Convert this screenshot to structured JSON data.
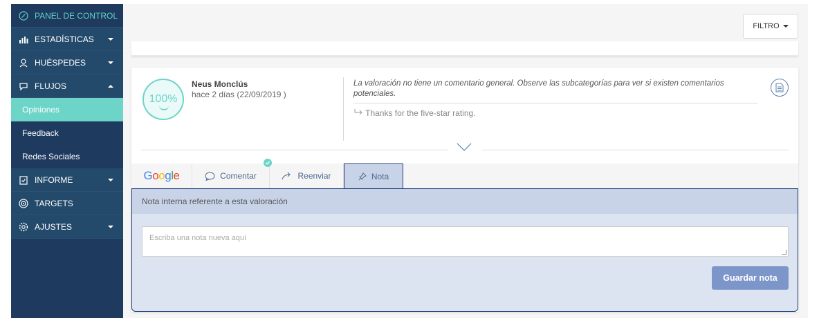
{
  "sidebar": {
    "top": {
      "label": "PANEL DE CONTROL",
      "icon": "compass-icon"
    },
    "items": [
      {
        "label": "ESTADÍSTICAS",
        "icon": "bar-chart-icon",
        "caret": "down"
      },
      {
        "label": "HUÉSPEDES",
        "icon": "user-icon",
        "caret": "down"
      },
      {
        "label": "FLUJOS",
        "icon": "chat-icon",
        "caret": "up"
      }
    ],
    "subitems": [
      "Opiniones",
      "Feedback",
      "Redes Sociales"
    ],
    "items2": [
      {
        "label": "INFORME",
        "icon": "clipboard-icon",
        "caret": "down"
      },
      {
        "label": "TARGETS",
        "icon": "target-icon",
        "caret": ""
      },
      {
        "label": "AJUSTES",
        "icon": "gear-icon",
        "caret": "down"
      }
    ]
  },
  "topbar": {
    "filter_label": "FILTRO"
  },
  "review": {
    "score": "100%",
    "author": "Neus Monclús",
    "date": "hace 2 días (22/09/2019 )",
    "comment": "La valoración no tiene un comentario general. Observe las subcategorías para ver si existen comentarios potenciales.",
    "reply": "Thanks for the five-star rating."
  },
  "tabs": {
    "source": "Google",
    "comment": "Comentar",
    "forward": "Reenviar",
    "note": "Nota"
  },
  "note": {
    "header": "Nota interna referente a esta valoración",
    "placeholder": "Escriba una nota nueva aquí",
    "save_label": "Guardar nota"
  },
  "colors": {
    "sidebar": "#1e3a5f",
    "accent": "#6dd4c8",
    "button": "#7d96c9"
  }
}
